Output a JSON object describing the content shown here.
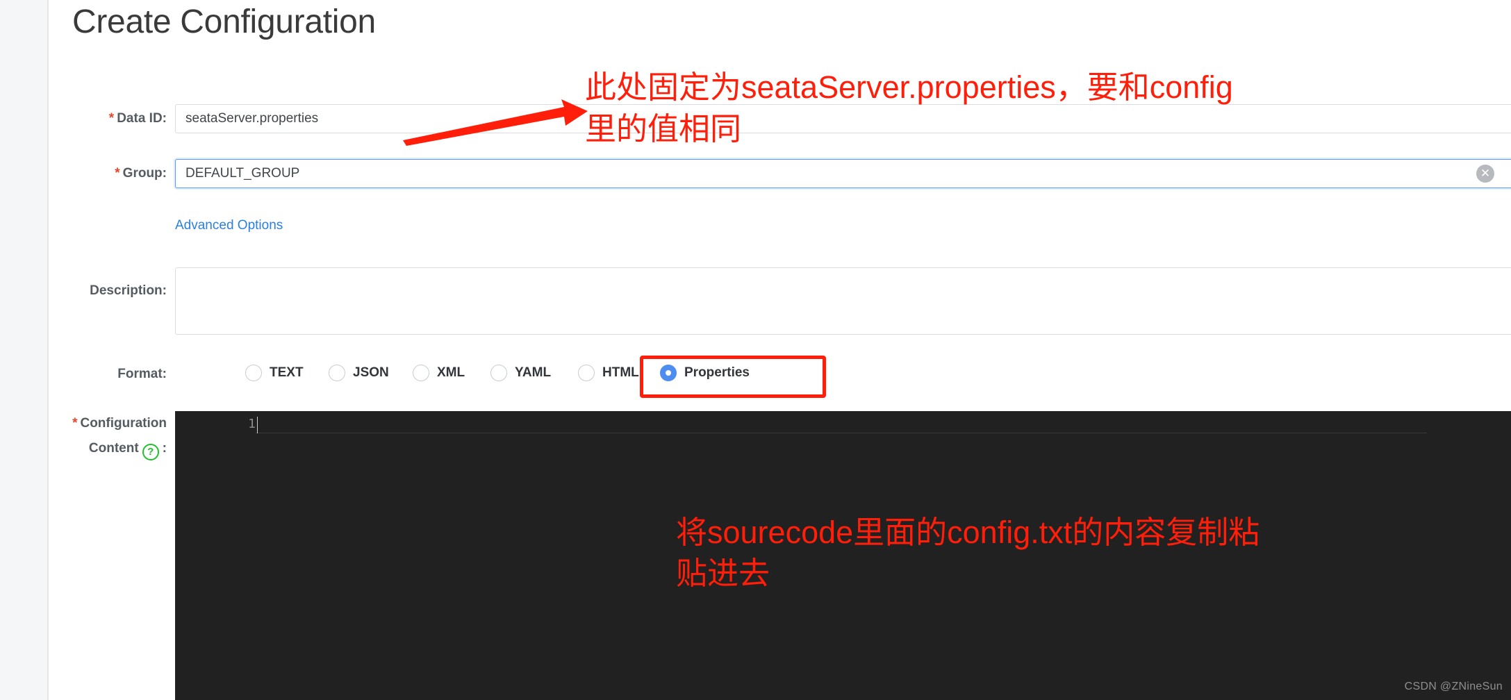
{
  "page": {
    "title": "Create Configuration"
  },
  "form": {
    "data_id": {
      "label": "Data ID:",
      "required_marker": "*",
      "value": "seataServer.properties",
      "placeholder": "Data ID"
    },
    "group": {
      "label": "Group:",
      "required_marker": "*",
      "value": "DEFAULT_GROUP",
      "placeholder": "Group",
      "clear_icon": "clear-circle-icon",
      "clear_glyph": "✕"
    },
    "advanced_options": {
      "label": "Advanced Options"
    },
    "description": {
      "label": "Description:",
      "value": "",
      "placeholder": ""
    },
    "format": {
      "label": "Format:",
      "selected": "Properties",
      "options": [
        {
          "label": "TEXT",
          "checked": false
        },
        {
          "label": "JSON",
          "checked": false
        },
        {
          "label": "XML",
          "checked": false
        },
        {
          "label": "YAML",
          "checked": false
        },
        {
          "label": "HTML",
          "checked": false
        },
        {
          "label": "Properties",
          "checked": true
        }
      ]
    },
    "configuration_content": {
      "required_marker": "*",
      "label_line1": "Configuration",
      "label_line2": "Content",
      "label_suffix": ":",
      "help_icon": "question-mark-help-icon",
      "help_glyph": "?",
      "line_number": "1",
      "value": ""
    }
  },
  "annotations": {
    "top": {
      "line1": "此处固定为seataServer.properties，要和config",
      "line2": "里的值相同",
      "arrow_icon": "red-arrow-icon"
    },
    "properties_box": {
      "icon": "red-highlight-box"
    },
    "bottom": {
      "line1": "将sourecode里面的config.txt的内容复制粘",
      "line2": "贴进去"
    }
  },
  "watermark": {
    "text": "CSDN @ZNineSun"
  },
  "colors": {
    "annotation_red": "#fe1e09",
    "required_star": "#e8452c",
    "link_blue": "#2a7fe0",
    "radio_selected": "#4d8df0",
    "editor_background": "#212121",
    "help_green": "#1fc22b"
  }
}
